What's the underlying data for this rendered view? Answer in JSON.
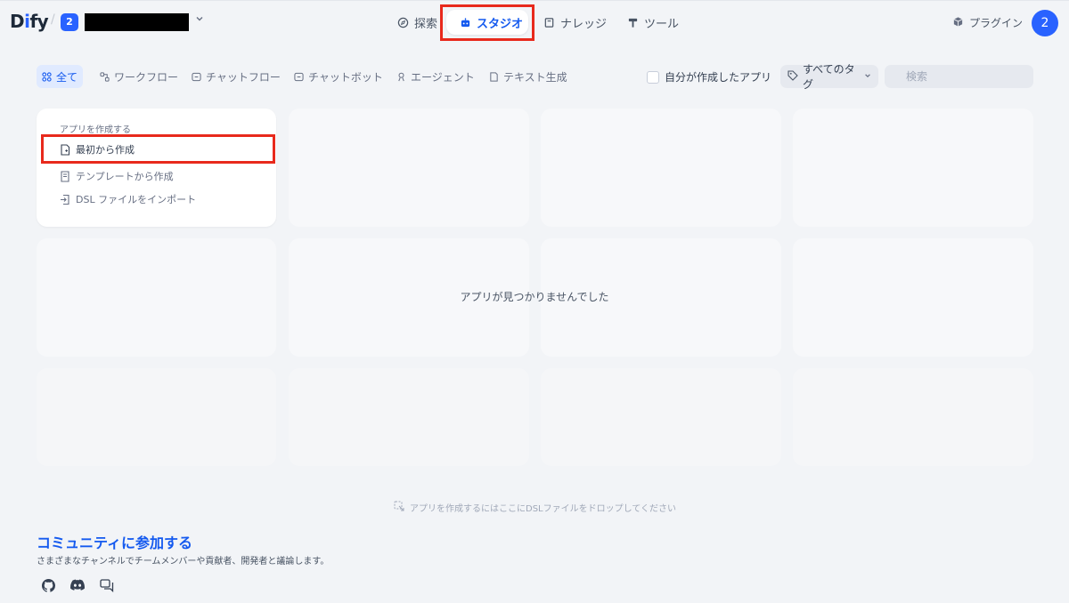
{
  "header": {
    "logo_prefix": "D",
    "logo_i": "i",
    "logo_suffix": "fy",
    "slash": "/",
    "workspace_badge": "2",
    "nav": {
      "explore": "探索",
      "studio": "スタジオ",
      "knowledge": "ナレッジ",
      "tools": "ツール"
    },
    "plugin": "プラグイン",
    "avatar": "2"
  },
  "filters": {
    "tabs": [
      "全て",
      "ワークフロー",
      "チャットフロー",
      "チャットボット",
      "エージェント",
      "テキスト生成"
    ],
    "mine_label": "自分が作成したアプリ",
    "tags_label": "すべてのタグ",
    "search_placeholder": "検索"
  },
  "create_card": {
    "title": "アプリを作成する",
    "blank": "最初から作成",
    "template": "テンプレートから作成",
    "dsl": "DSL ファイルをインポート"
  },
  "empty_text": "アプリが見つかりませんでした",
  "drop_hint": "アプリを作成するにはここにDSLファイルをドロップしてください",
  "community": {
    "title": "コミュニティに参加する",
    "subtitle": "さまざまなチャンネルでチームメンバーや貢献者、開発者と議論します。"
  },
  "colors": {
    "accent": "#155aef",
    "highlight": "#e8291c",
    "background": "#f2f4f7"
  },
  "icons": {
    "explore": "compass-icon",
    "studio": "robot-icon",
    "knowledge": "book-icon",
    "tools": "hammer-icon",
    "plugin": "cube-icon",
    "social": [
      "github-icon",
      "discord-icon",
      "forum-icon"
    ]
  }
}
